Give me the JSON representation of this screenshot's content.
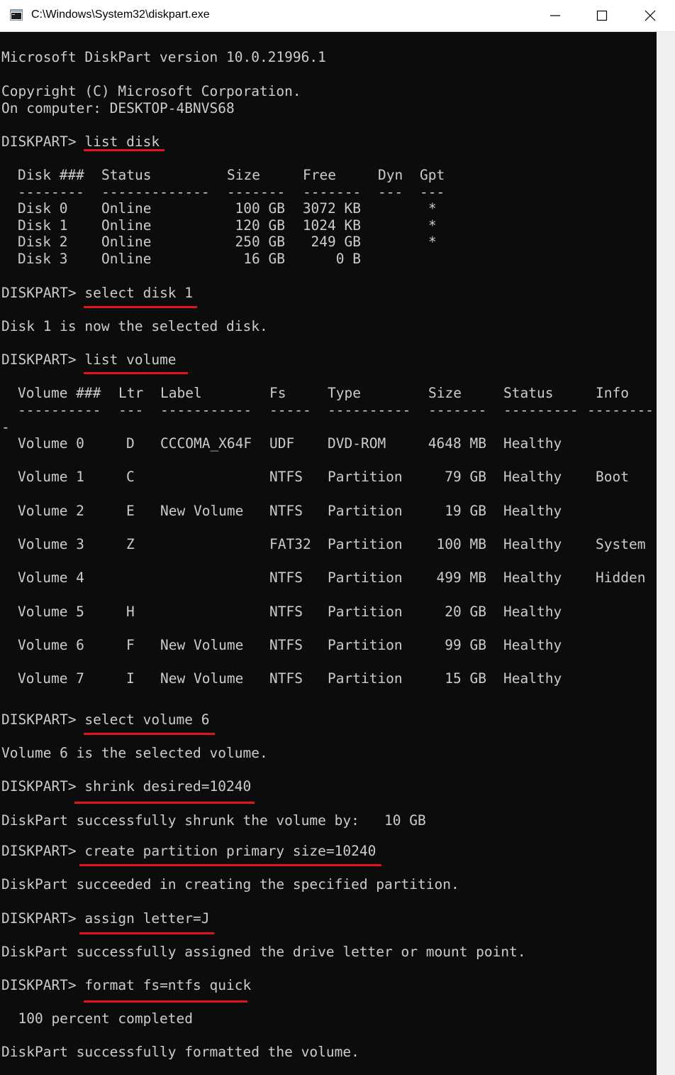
{
  "window": {
    "title": "C:\\Windows\\System32\\diskpart.exe",
    "icon": "console-window-icon",
    "controls": [
      "minimize-icon",
      "maximize-icon",
      "close-icon"
    ]
  },
  "colors": {
    "console_bg": "#0c0c0c",
    "console_fg": "#cccccc",
    "highlight": "#e0161b"
  },
  "console": {
    "version": "Microsoft DiskPart version 10.0.21996.1",
    "copyright": "Copyright (C) Microsoft Corporation.",
    "computer": "On computer: DESKTOP-4BNVS68",
    "prompt": "DISKPART> ",
    "commands": {
      "list_disk": "list disk",
      "select_disk": "select disk 1",
      "list_volume": "list volume",
      "select_volume": "select volume 6",
      "shrink": "shrink desired=10240",
      "create": "create partition primary size=10240",
      "assign": "assign letter=J",
      "format": "format fs=ntfs quick"
    },
    "disk_table": {
      "headers": {
        "disk": "Disk ###",
        "status": "Status",
        "size": "Size",
        "free": "Free",
        "dyn": "Dyn",
        "gpt": "Gpt"
      },
      "dashes": {
        "disk": "--------",
        "status": "-------------",
        "size": "-------",
        "free": "-------",
        "dyn": "---",
        "gpt": "---"
      },
      "rows": [
        {
          "disk": "Disk 0",
          "status": "Online",
          "size": "100 GB",
          "free": "3072 KB",
          "dyn": "",
          "gpt": "*"
        },
        {
          "disk": "Disk 1",
          "status": "Online",
          "size": "120 GB",
          "free": "1024 KB",
          "dyn": "",
          "gpt": "*"
        },
        {
          "disk": "Disk 2",
          "status": "Online",
          "size": "250 GB",
          "free": "249 GB",
          "dyn": "",
          "gpt": "*"
        },
        {
          "disk": "Disk 3",
          "status": "Online",
          "size": "16 GB",
          "free": "0 B",
          "dyn": "",
          "gpt": ""
        }
      ]
    },
    "disk_selected_msg": "Disk 1 is now the selected disk.",
    "volume_table": {
      "headers": {
        "volume": "Volume ###",
        "ltr": "Ltr",
        "label": "Label",
        "fs": "Fs",
        "type": "Type",
        "size": "Size",
        "status": "Status",
        "info": "Info"
      },
      "dashes": {
        "volume": "----------",
        "ltr": "---",
        "label": "-----------",
        "fs": "-----",
        "type": "----------",
        "size": "-------",
        "status": "---------",
        "info": "--------"
      },
      "wrap": "-",
      "rows": [
        {
          "volume": "Volume 0",
          "ltr": "D",
          "label": "CCCOMA_X64F",
          "fs": "UDF",
          "type": "DVD-ROM",
          "size": "4648 MB",
          "status": "Healthy",
          "info": ""
        },
        {
          "volume": "Volume 1",
          "ltr": "C",
          "label": "",
          "fs": "NTFS",
          "type": "Partition",
          "size": "79 GB",
          "status": "Healthy",
          "info": "Boot"
        },
        {
          "volume": "Volume 2",
          "ltr": "E",
          "label": "New Volume",
          "fs": "NTFS",
          "type": "Partition",
          "size": "19 GB",
          "status": "Healthy",
          "info": ""
        },
        {
          "volume": "Volume 3",
          "ltr": "Z",
          "label": "",
          "fs": "FAT32",
          "type": "Partition",
          "size": "100 MB",
          "status": "Healthy",
          "info": "System"
        },
        {
          "volume": "Volume 4",
          "ltr": "",
          "label": "",
          "fs": "NTFS",
          "type": "Partition",
          "size": "499 MB",
          "status": "Healthy",
          "info": "Hidden"
        },
        {
          "volume": "Volume 5",
          "ltr": "H",
          "label": "",
          "fs": "NTFS",
          "type": "Partition",
          "size": "20 GB",
          "status": "Healthy",
          "info": ""
        },
        {
          "volume": "Volume 6",
          "ltr": "F",
          "label": "New Volume",
          "fs": "NTFS",
          "type": "Partition",
          "size": "99 GB",
          "status": "Healthy",
          "info": ""
        },
        {
          "volume": "Volume 7",
          "ltr": "I",
          "label": "New Volume",
          "fs": "NTFS",
          "type": "Partition",
          "size": "15 GB",
          "status": "Healthy",
          "info": ""
        }
      ]
    },
    "volume_selected_msg": "Volume 6 is the selected volume.",
    "shrink_msg": "DiskPart successfully shrunk the volume by:   10 GB",
    "create_msg": "DiskPart succeeded in creating the specified partition.",
    "assign_msg": "DiskPart successfully assigned the drive letter or mount point.",
    "format_progress": "  100 percent completed",
    "format_msg": "DiskPart successfully formatted the volume."
  }
}
